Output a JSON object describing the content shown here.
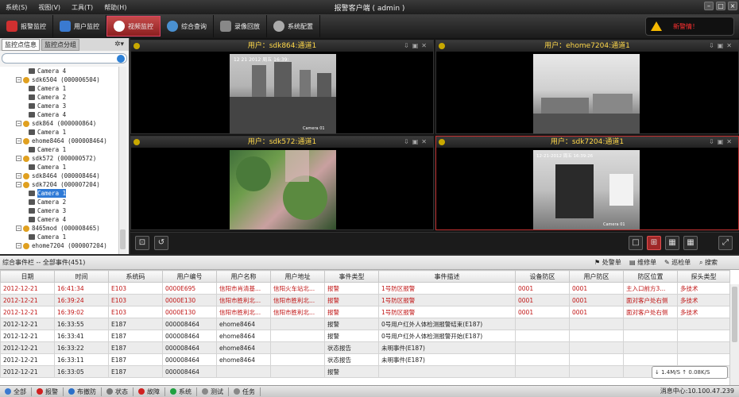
{
  "window": {
    "title": "报警客户端 ( admin )"
  },
  "menu": [
    "系统(S)",
    "视图(V)",
    "工具(T)",
    "帮助(H)"
  ],
  "toolbar": [
    {
      "label": "报警监控",
      "icon": "alarm-monitor-icon",
      "color": "#d03030"
    },
    {
      "label": "用户监控",
      "icon": "user-monitor-icon",
      "color": "#3a7ad0"
    },
    {
      "label": "视频监控",
      "icon": "video-monitor-icon",
      "color": "#ffffff"
    },
    {
      "label": "综合查询",
      "icon": "search-icon",
      "color": "#4a90d0"
    },
    {
      "label": "录像回放",
      "icon": "playback-icon",
      "color": "#888888"
    },
    {
      "label": "系统配置",
      "icon": "gear-icon",
      "color": "#aaaaaa"
    }
  ],
  "alarm_button": {
    "label": "新警情！"
  },
  "left_panel": {
    "tabs": [
      "监控点信息",
      "监控点分组"
    ],
    "tree": [
      {
        "label": "Camera 4",
        "level": 3,
        "type": "camera"
      },
      {
        "label": "sdk6504 (000006504)",
        "level": 1,
        "type": "user"
      },
      {
        "label": "Camera 1",
        "level": 3,
        "type": "camera"
      },
      {
        "label": "Camera 2",
        "level": 3,
        "type": "camera"
      },
      {
        "label": "Camera 3",
        "level": 3,
        "type": "camera"
      },
      {
        "label": "Camera 4",
        "level": 3,
        "type": "camera"
      },
      {
        "label": "sdk864 (000000864)",
        "level": 1,
        "type": "user"
      },
      {
        "label": "Camera 1",
        "level": 3,
        "type": "camera"
      },
      {
        "label": "ehome8464 (000008464)",
        "level": 1,
        "type": "user"
      },
      {
        "label": "Camera 1",
        "level": 3,
        "type": "camera"
      },
      {
        "label": "sdk572 (000000572)",
        "level": 1,
        "type": "user"
      },
      {
        "label": "Camera 1",
        "level": 3,
        "type": "camera"
      },
      {
        "label": "sdk8464 (000008464)",
        "level": 1,
        "type": "user"
      },
      {
        "label": "sdk7204 (000007204)",
        "level": 1,
        "type": "user"
      },
      {
        "label": "Camera 1",
        "level": 3,
        "type": "camera",
        "selected": true
      },
      {
        "label": "Camera 2",
        "level": 3,
        "type": "camera"
      },
      {
        "label": "Camera 3",
        "level": 3,
        "type": "camera"
      },
      {
        "label": "Camera 4",
        "level": 3,
        "type": "camera"
      },
      {
        "label": "8465mod (000008465)",
        "level": 1,
        "type": "user"
      },
      {
        "label": "Camera 1",
        "level": 3,
        "type": "camera"
      },
      {
        "label": "ehome7204 (000007204)",
        "level": 1,
        "type": "user"
      }
    ]
  },
  "video": {
    "cells": [
      {
        "title": "用户：sdk864:通道1",
        "osd_time": "12 21 2012 周五 16:39:",
        "osd_cam": "Camera 01"
      },
      {
        "title": "用户：ehome7204:通道1",
        "osd_time": "",
        "osd_cam": ""
      },
      {
        "title": "用户：sdk572:通道1",
        "osd_time": "",
        "osd_cam": ""
      },
      {
        "title": "用户：sdk7204:通道1",
        "osd_time": "12-21-2012 周五 16:39:26",
        "osd_cam": "Camera 01"
      }
    ]
  },
  "events": {
    "title": "综合事件栏 -- 全部事件(451)",
    "actions": [
      "处警单",
      "维修单",
      "巡检单",
      "搜索"
    ],
    "columns": [
      "日期",
      "时间",
      "系统码",
      "用户编号",
      "用户名称",
      "用户地址",
      "事件类型",
      "事件描述",
      "设备防区",
      "用户防区",
      "防区位置",
      "探头类型"
    ],
    "rows": [
      {
        "cells": [
          "2012-12-21",
          "16:41:34",
          "E103",
          "0000E695",
          "信阳市肖清基...",
          "信阳火车站北...",
          "报警",
          "1号防区报警",
          "0001",
          "0001",
          "主入口前方3...",
          "多技术"
        ],
        "alarm": true
      },
      {
        "cells": [
          "2012-12-21",
          "16:39:24",
          "E103",
          "0000E130",
          "信阳市胜利北...",
          "信阳市胜利北...",
          "报警",
          "1号防区报警",
          "0001",
          "0001",
          "面对客户处右侧",
          "多技术"
        ],
        "alarm": true
      },
      {
        "cells": [
          "2012-12-21",
          "16:39:02",
          "E103",
          "0000E130",
          "信阳市胜利北...",
          "信阳市胜利北...",
          "报警",
          "1号防区报警",
          "0001",
          "0001",
          "面对客户处右侧",
          "多技术"
        ],
        "alarm": true
      },
      {
        "cells": [
          "2012-12-21",
          "16:33:55",
          "E187",
          "000008464",
          "ehome8464",
          "",
          "报警",
          "0号用户红外人体检测报警结束(E187)",
          "",
          "",
          "",
          ""
        ],
        "alarm": false
      },
      {
        "cells": [
          "2012-12-21",
          "16:33:41",
          "E187",
          "000008464",
          "ehome8464",
          "",
          "报警",
          "0号用户红外人体检测报警开始(E187)",
          "",
          "",
          "",
          ""
        ],
        "alarm": false
      },
      {
        "cells": [
          "2012-12-21",
          "16:33:22",
          "E187",
          "000008464",
          "ehome8464",
          "",
          "状态报告",
          "未明事件(E187)",
          "",
          "",
          "",
          ""
        ],
        "alarm": false
      },
      {
        "cells": [
          "2012-12-21",
          "16:33:11",
          "E187",
          "000008464",
          "ehome8464",
          "",
          "状态报告",
          "未明事件(E187)",
          "",
          "",
          "",
          ""
        ],
        "alarm": false
      },
      {
        "cells": [
          "2012-12-21",
          "16:33:05",
          "E187",
          "000008464",
          "",
          "",
          "报警",
          "",
          "",
          "",
          "",
          ""
        ],
        "alarm": false
      }
    ]
  },
  "speed": {
    "up": "1.4M/S",
    "down": "0.08K/S"
  },
  "statusbar": [
    {
      "label": "全部",
      "color": "#3a7ad0"
    },
    {
      "label": "报警",
      "color": "#d02020"
    },
    {
      "label": "布撤防",
      "color": "#2a6fc8"
    },
    {
      "label": "状态",
      "color": "#777777"
    },
    {
      "label": "故障",
      "color": "#d02020"
    },
    {
      "label": "系统",
      "color": "#20a040"
    },
    {
      "label": "测试",
      "color": "#888888"
    },
    {
      "label": "任务",
      "color": "#888888"
    }
  ],
  "message_center": "消息中心:10.100.47.239"
}
